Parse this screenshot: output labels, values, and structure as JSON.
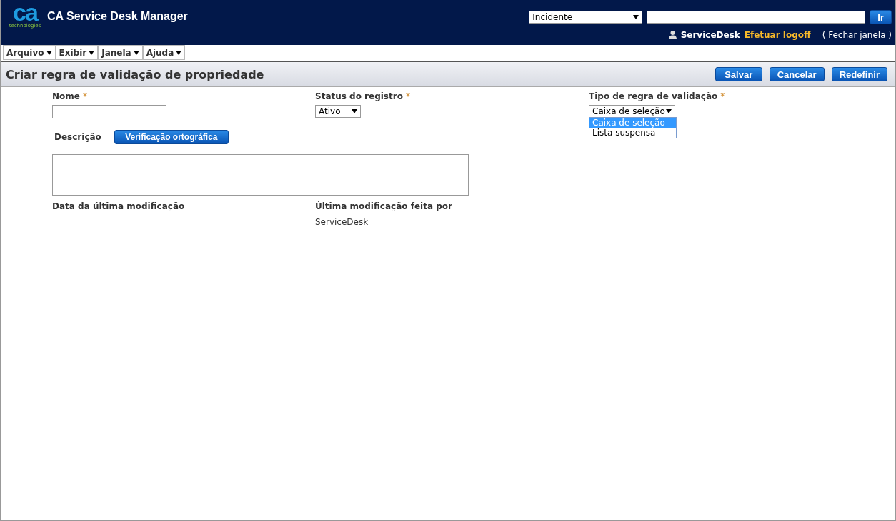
{
  "header": {
    "logo_text": "ca",
    "logo_subtext": "technologies",
    "product": "CA Service Desk Manager",
    "search_type": "Incidente",
    "go_button": "Ir",
    "user": "ServiceDesk",
    "logoff": "Efetuar logoff",
    "close_window": "( Fechar janela )"
  },
  "menu": [
    {
      "label": "Arquivo"
    },
    {
      "label": "Exibir"
    },
    {
      "label": "Janela"
    },
    {
      "label": "Ajuda"
    }
  ],
  "page_title": "Criar regra de validação de propriedade",
  "actions": [
    "Salvar",
    "Cancelar",
    "Redefinir"
  ],
  "form": {
    "name": {
      "label": "Nome",
      "required": "*"
    },
    "status": {
      "label": "Status do registro",
      "required": "*",
      "value": "Ativo"
    },
    "rule_type": {
      "label": "Tipo de regra de validação",
      "required": "*",
      "value": "Caixa de seleção",
      "expanded": true,
      "options": [
        {
          "label": "Caixa de seleção",
          "selected": true
        },
        {
          "label": "Lista suspensa",
          "selected": false
        }
      ]
    },
    "description": {
      "label": "Descrição",
      "spell_button": "Verificação ortográfica"
    },
    "modified_date": {
      "label": "Data da última modificação"
    },
    "modified_by": {
      "label": "Última modificação feita por",
      "value": "ServiceDesk"
    }
  }
}
